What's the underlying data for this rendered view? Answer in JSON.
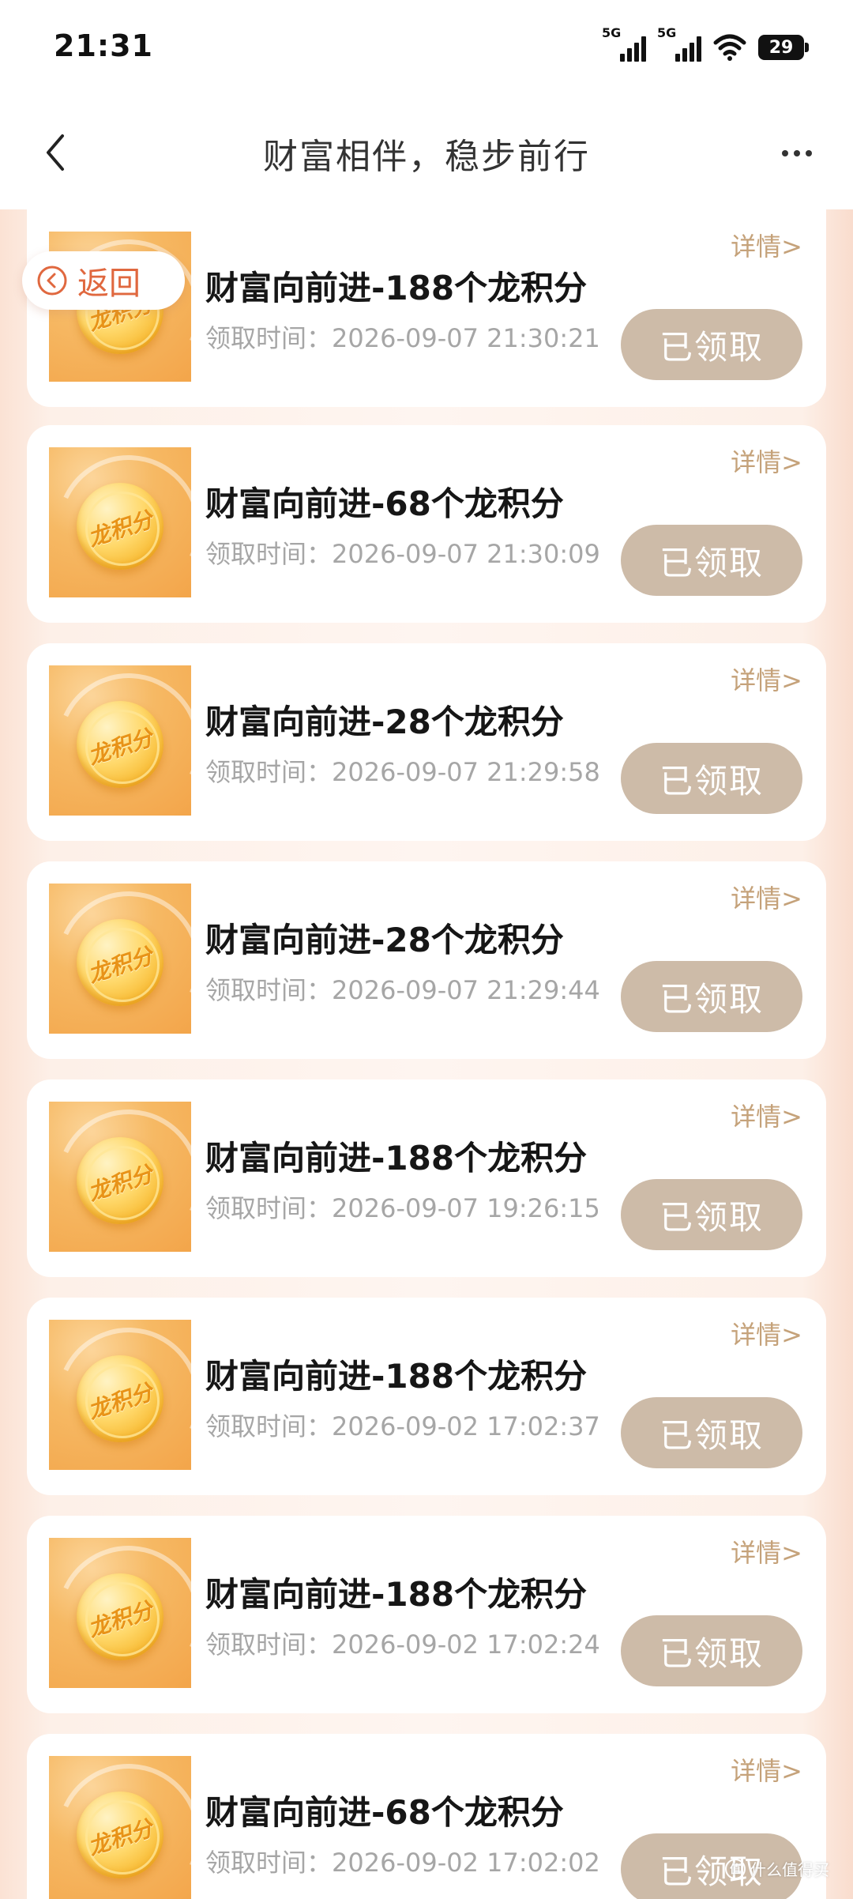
{
  "status_bar": {
    "time": "21:31",
    "network_1": "5G",
    "network_2": "5G",
    "battery": "29"
  },
  "nav": {
    "title": "财富相伴，稳步前行",
    "back_icon": "chevron-left-icon",
    "more_icon": "more-dots-icon"
  },
  "float_back": {
    "label": "返回",
    "icon": "circle-chevron-left-icon"
  },
  "records": [
    {
      "title": "财富向前进-188个龙积分",
      "time": "领取时间：2026-09-07 21:30:21",
      "detail": "详情>",
      "status": "已领取",
      "coin_text": "龙积分"
    },
    {
      "title": "财富向前进-68个龙积分",
      "time": "领取时间：2026-09-07 21:30:09",
      "detail": "详情>",
      "status": "已领取",
      "coin_text": "龙积分"
    },
    {
      "title": "财富向前进-28个龙积分",
      "time": "领取时间：2026-09-07 21:29:58",
      "detail": "详情>",
      "status": "已领取",
      "coin_text": "龙积分"
    },
    {
      "title": "财富向前进-28个龙积分",
      "time": "领取时间：2026-09-07 21:29:44",
      "detail": "详情>",
      "status": "已领取",
      "coin_text": "龙积分"
    },
    {
      "title": "财富向前进-188个龙积分",
      "time": "领取时间：2026-09-07 19:26:15",
      "detail": "详情>",
      "status": "已领取",
      "coin_text": "龙积分"
    },
    {
      "title": "财富向前进-188个龙积分",
      "time": "领取时间：2026-09-02 17:02:37",
      "detail": "详情>",
      "status": "已领取",
      "coin_text": "龙积分"
    },
    {
      "title": "财富向前进-188个龙积分",
      "time": "领取时间：2026-09-02 17:02:24",
      "detail": "详情>",
      "status": "已领取",
      "coin_text": "龙积分"
    },
    {
      "title": "财富向前进-68个龙积分",
      "time": "领取时间：2026-09-02 17:02:02",
      "detail": "详情>",
      "status": "已领取",
      "coin_text": "龙积分"
    }
  ],
  "watermark": {
    "text": "什么值得买",
    "mark": "值"
  },
  "colors": {
    "status_button_bg": "#cdbba8",
    "detail_link": "#c5a27a",
    "back_accent": "#e0683f"
  }
}
